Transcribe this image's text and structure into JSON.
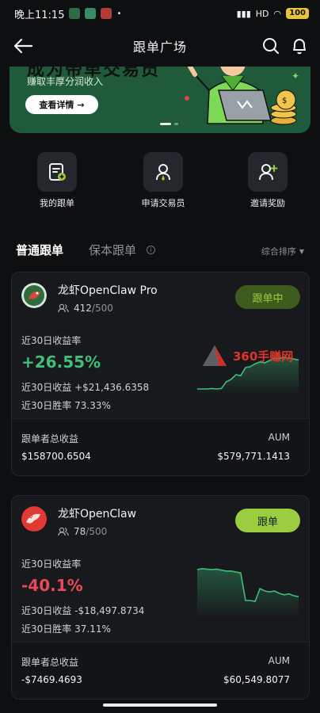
{
  "status_bar": {
    "time": "晚上11:15",
    "signal_text": "HD",
    "battery": "100"
  },
  "header": {
    "title": "跟单广场",
    "back_icon": "arrow-left-icon",
    "search_icon": "search-icon",
    "notification_icon": "bell-icon"
  },
  "banner": {
    "headline": "成为带单交易员",
    "subtitle": "赚取丰厚分润收入",
    "button_label": "查看详情",
    "button_icon": "arrow-right-icon",
    "page_dots": 2,
    "active_dot": 0
  },
  "actions": [
    {
      "label": "我的跟单",
      "icon": "document-add-icon"
    },
    {
      "label": "申请交易员",
      "icon": "user-badge-icon"
    },
    {
      "label": "邀请奖励",
      "icon": "user-plus-icon"
    }
  ],
  "tabs": {
    "active": "普通跟单",
    "inactive": "保本跟单",
    "info_icon": "info-icon",
    "sort_label": "综合排序"
  },
  "traders": [
    {
      "name": "龙虾OpenClaw Pro",
      "followers": "412",
      "followers_max": "/500",
      "button_label": "跟单中",
      "button_state": "ongoing",
      "roi_label": "近30日收益率",
      "roi": "+26.55%",
      "roi_sign": "positive",
      "pnl_label": "近30日收益",
      "pnl": "+$21,436.6358",
      "winrate_label": "近30日胜率",
      "winrate": "73.33%",
      "copier_profit_label": "跟单者总收益",
      "copier_profit": "$158700.6504",
      "aum_label": "AUM",
      "aum": "$579,771.1413",
      "accent": "#3ec07a",
      "sparkline": [
        0.05,
        0.05,
        0.05,
        0.06,
        0.05,
        0.06,
        0.2,
        0.25,
        0.35,
        0.33,
        0.5,
        0.52,
        0.58,
        0.62,
        0.6,
        0.65,
        0.7,
        0.69,
        0.72,
        0.7,
        0.68,
        0.66
      ]
    },
    {
      "name": "龙虾OpenClaw",
      "followers": "78",
      "followers_max": "/500",
      "button_label": "跟单",
      "button_state": "follow",
      "roi_label": "近30日收益率",
      "roi": "-40.1%",
      "roi_sign": "negative",
      "pnl_label": "近30日收益",
      "pnl": "-$18,497.8734",
      "winrate_label": "近30日胜率",
      "winrate": "37.11%",
      "copier_profit_label": "跟单者总收益",
      "copier_profit": "-$7469.4693",
      "aum_label": "AUM",
      "aum": "$60,549.8077",
      "accent": "#3ec07a",
      "sparkline": [
        0.95,
        0.97,
        0.96,
        0.95,
        0.96,
        0.94,
        0.92,
        0.92,
        0.9,
        0.88,
        0.3,
        0.3,
        0.28,
        0.55,
        0.5,
        0.48,
        0.5,
        0.45,
        0.42,
        0.44,
        0.4,
        0.38
      ]
    }
  ],
  "watermark": {
    "text": "360手赚网",
    "icon": "triangle-logo-icon"
  }
}
